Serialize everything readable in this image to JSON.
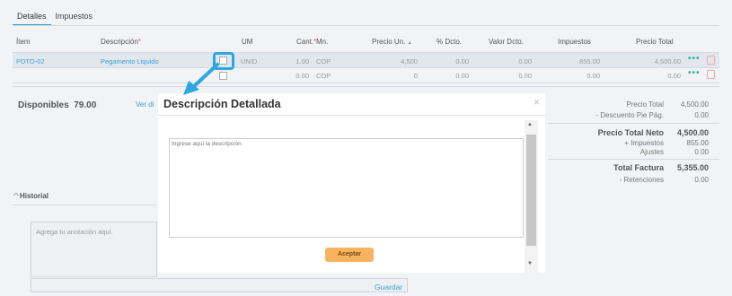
{
  "tabs": [
    "Detalles",
    "Impuestos"
  ],
  "columns": [
    "Ítem",
    "Descripción",
    "UM",
    "Cant.",
    "Mn.",
    "Precio Un.",
    "% Dcto.",
    "Valor Dcto.",
    "Impuestos",
    "Precio Total"
  ],
  "sort_indicator": "▲",
  "required_mark": "*",
  "row1": {
    "item": "PDTO-02",
    "descripcion": "Pegamento Liquido",
    "um": "UNID",
    "cant": "1.00",
    "mn": "COP",
    "precio_un": "4,500",
    "dcto": "0.00",
    "valor_dcto": "0.00",
    "impuestos": "855.00",
    "precio_total": "4,500.00"
  },
  "row2": {
    "cant": "0.00",
    "mn": "COP",
    "precio_un": "0",
    "dcto": "0.00",
    "valor_dcto": "0.00",
    "impuestos": "0.00",
    "precio_total": "0.00"
  },
  "row_actions": {
    "more": "•••"
  },
  "disponibles_label": "Disponibles",
  "disponibles_value": "79.00",
  "ver_link": "Ver di",
  "historial_label": "Historial",
  "historial_toggle": "^",
  "note_placeholder": "Agrega tu anotación aquí.",
  "guardar": "Guardar",
  "totals": {
    "precio_total_label": "Precio Total",
    "precio_total": "4,500.00",
    "descuento_label": "- Descuento Pie Pág.",
    "descuento": "0.00",
    "neto_label": "Precio Total Neto",
    "neto": "4,500.00",
    "impuestos_label": "+ Impuestos",
    "impuestos": "855.00",
    "ajustes_label": "Ajustes",
    "ajustes": "0.00",
    "factura_label": "Total Factura",
    "factura": "5,355.00",
    "retenciones_label": "- Retenciones",
    "retenciones": "0.00"
  },
  "modal": {
    "title": "Descripción Detallada",
    "close": "×",
    "placeholder": "Ingrese aquí la descripción",
    "accept": "Aceptar",
    "scroll_up": "▲",
    "scroll_down": "▼"
  },
  "colors": {
    "accent": "#29a3d8",
    "link": "#3aa0d0",
    "accept": "#f7b360",
    "dots": "#39b39a"
  }
}
